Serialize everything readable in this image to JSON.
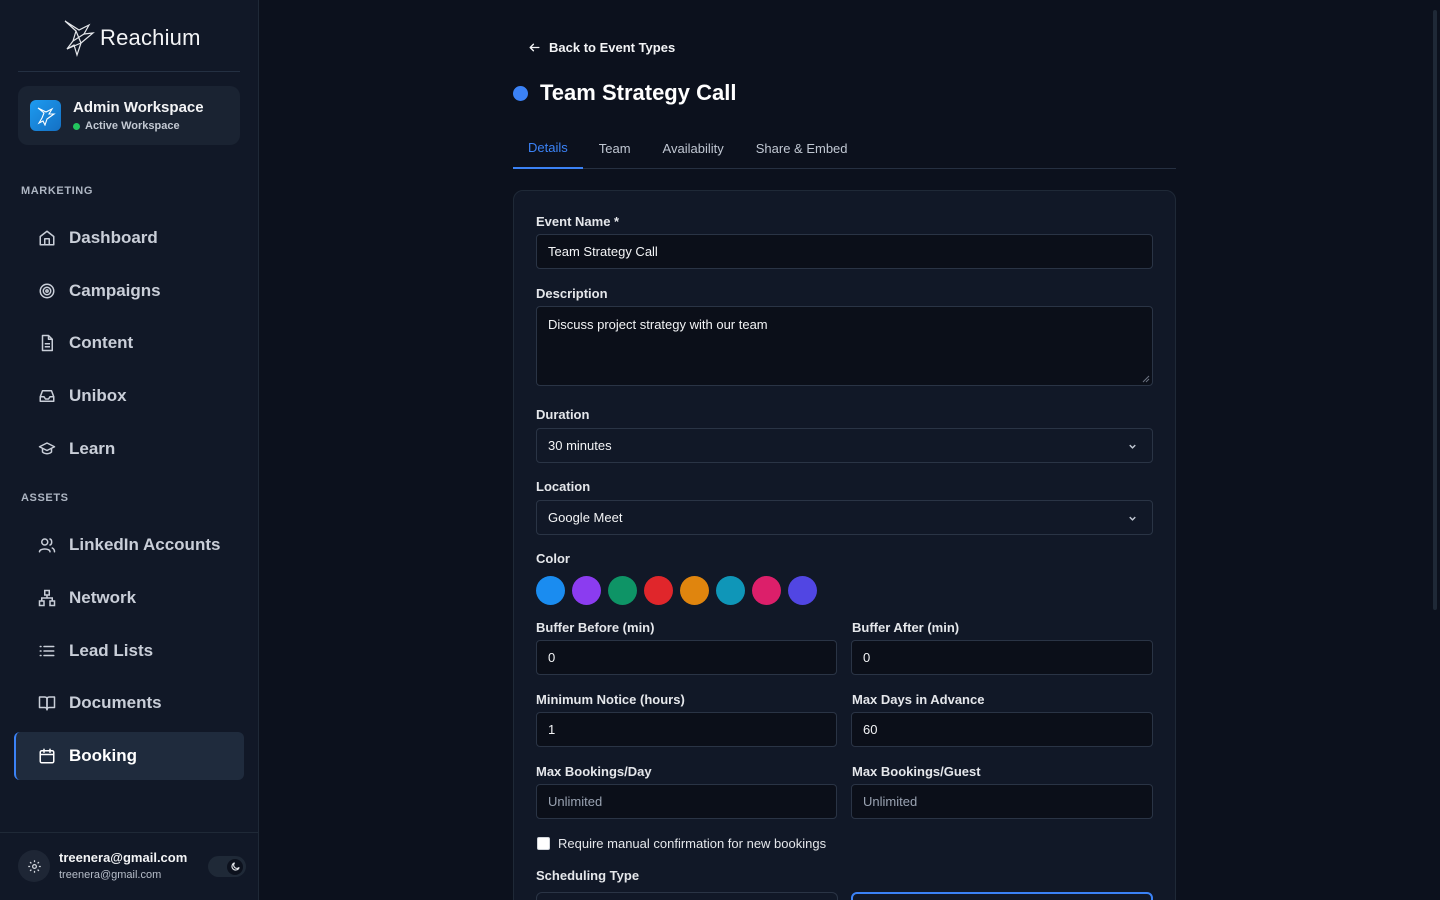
{
  "app": {
    "name": "Reachium"
  },
  "workspace": {
    "name": "Admin Workspace",
    "status": "Active Workspace"
  },
  "sidebar": {
    "sections": [
      {
        "label": "MARKETING"
      },
      {
        "label": "ASSETS"
      }
    ],
    "items": [
      {
        "label": "Dashboard",
        "icon": "home-icon"
      },
      {
        "label": "Campaigns",
        "icon": "target-icon"
      },
      {
        "label": "Content",
        "icon": "document-icon"
      },
      {
        "label": "Unibox",
        "icon": "inbox-icon"
      },
      {
        "label": "Learn",
        "icon": "graduation-cap-icon"
      },
      {
        "label": "LinkedIn Accounts",
        "icon": "users-icon"
      },
      {
        "label": "Network",
        "icon": "network-icon"
      },
      {
        "label": "Lead Lists",
        "icon": "list-icon"
      },
      {
        "label": "Documents",
        "icon": "book-icon"
      },
      {
        "label": "Booking",
        "icon": "calendar-icon",
        "active": true
      }
    ]
  },
  "user": {
    "name": "treenera@gmail.com",
    "email": "treenera@gmail.com"
  },
  "page": {
    "back_label": "Back to Event Types",
    "title": "Team Strategy Call",
    "title_color": "#3b82f6",
    "tabs": [
      {
        "label": "Details",
        "active": true
      },
      {
        "label": "Team"
      },
      {
        "label": "Availability"
      },
      {
        "label": "Share & Embed"
      }
    ]
  },
  "form": {
    "event_name": {
      "label": "Event Name *",
      "value": "Team Strategy Call"
    },
    "description": {
      "label": "Description",
      "value": "Discuss project strategy with our team"
    },
    "duration": {
      "label": "Duration",
      "value": "30 minutes"
    },
    "location": {
      "label": "Location",
      "value": "Google Meet"
    },
    "color": {
      "label": "Color",
      "options": [
        "#1a8cf0",
        "#8b3cf0",
        "#0e9466",
        "#e0262b",
        "#e0850e",
        "#0f96b8",
        "#dc1f6a",
        "#5146e3"
      ]
    },
    "buffer_before": {
      "label": "Buffer Before (min)",
      "value": "0"
    },
    "buffer_after": {
      "label": "Buffer After (min)",
      "value": "0"
    },
    "minimum_notice": {
      "label": "Minimum Notice (hours)",
      "value": "1"
    },
    "max_days_advance": {
      "label": "Max Days in Advance",
      "value": "60"
    },
    "max_bookings_day": {
      "label": "Max Bookings/Day",
      "placeholder": "Unlimited"
    },
    "max_bookings_guest": {
      "label": "Max Bookings/Guest",
      "placeholder": "Unlimited"
    },
    "manual_confirmation": {
      "label": "Require manual confirmation for new bookings",
      "checked": false
    },
    "scheduling_type": {
      "label": "Scheduling Type"
    }
  }
}
